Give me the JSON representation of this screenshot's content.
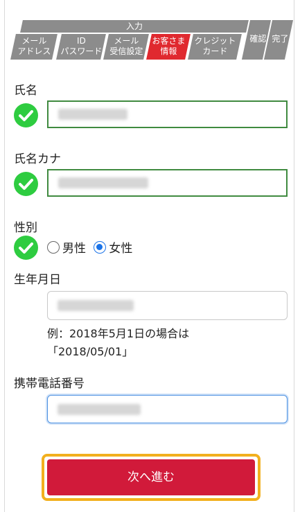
{
  "stepbar": {
    "group_label": "入力",
    "steps": [
      {
        "line1": "メール",
        "line2": "アドレス"
      },
      {
        "line1": "ID",
        "line2": "パスワード"
      },
      {
        "line1": "メール",
        "line2": "受信設定"
      },
      {
        "line1": "お客さま",
        "line2": "情報",
        "active": true
      },
      {
        "line1": "クレジット",
        "line2": "カード"
      },
      {
        "line1": "確認"
      },
      {
        "line1": "完了"
      }
    ],
    "active_color": "#e0292f",
    "inactive_color": "#8c8c8c"
  },
  "form": {
    "name": {
      "label": "氏名"
    },
    "name_kana": {
      "label": "氏名カナ"
    },
    "gender": {
      "label": "性別",
      "options": [
        "男性",
        "女性"
      ],
      "selected": "女性"
    },
    "birthdate": {
      "label": "生年月日",
      "hint_line1": "例：2018年5月1日の場合は",
      "hint_line2": "「2018/05/01」"
    },
    "mobile": {
      "label": "携帯電話番号"
    }
  },
  "actions": {
    "next_label": "次へ進む"
  },
  "colors": {
    "check": "#2ecc40",
    "primary_button": "#d11a3a",
    "focus_highlight": "#f2b01e"
  }
}
